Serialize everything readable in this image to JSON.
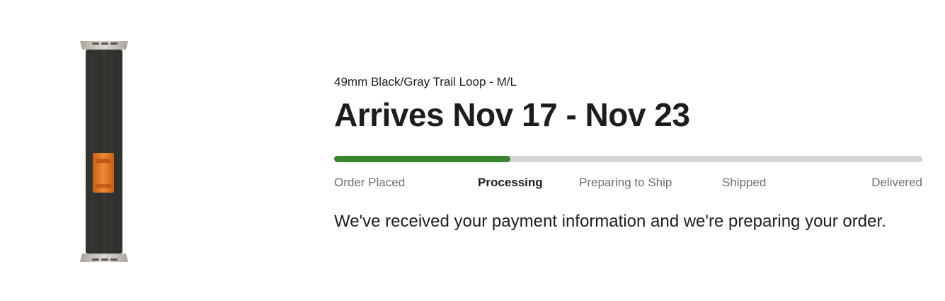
{
  "product": {
    "image_name": "trail-loop-band",
    "name": "49mm Black/Gray Trail Loop - M/L"
  },
  "delivery": {
    "arrival_text": "Arrives Nov 17 - Nov 23"
  },
  "progress": {
    "fraction": 0.3,
    "fill_color": "#3a8530",
    "track_color": "#d2d2d7",
    "steps": [
      {
        "label": "Order Placed",
        "active": false
      },
      {
        "label": "Processing",
        "active": true
      },
      {
        "label": "Preparing to Ship",
        "active": false
      },
      {
        "label": "Shipped",
        "active": false
      },
      {
        "label": "Delivered",
        "active": false
      }
    ]
  },
  "status": {
    "message": "We've received your payment information and we're preparing your order."
  },
  "colors": {
    "band_body": "#2f312d",
    "band_accent": "#e8782a",
    "connector": "#cdc8c0"
  }
}
